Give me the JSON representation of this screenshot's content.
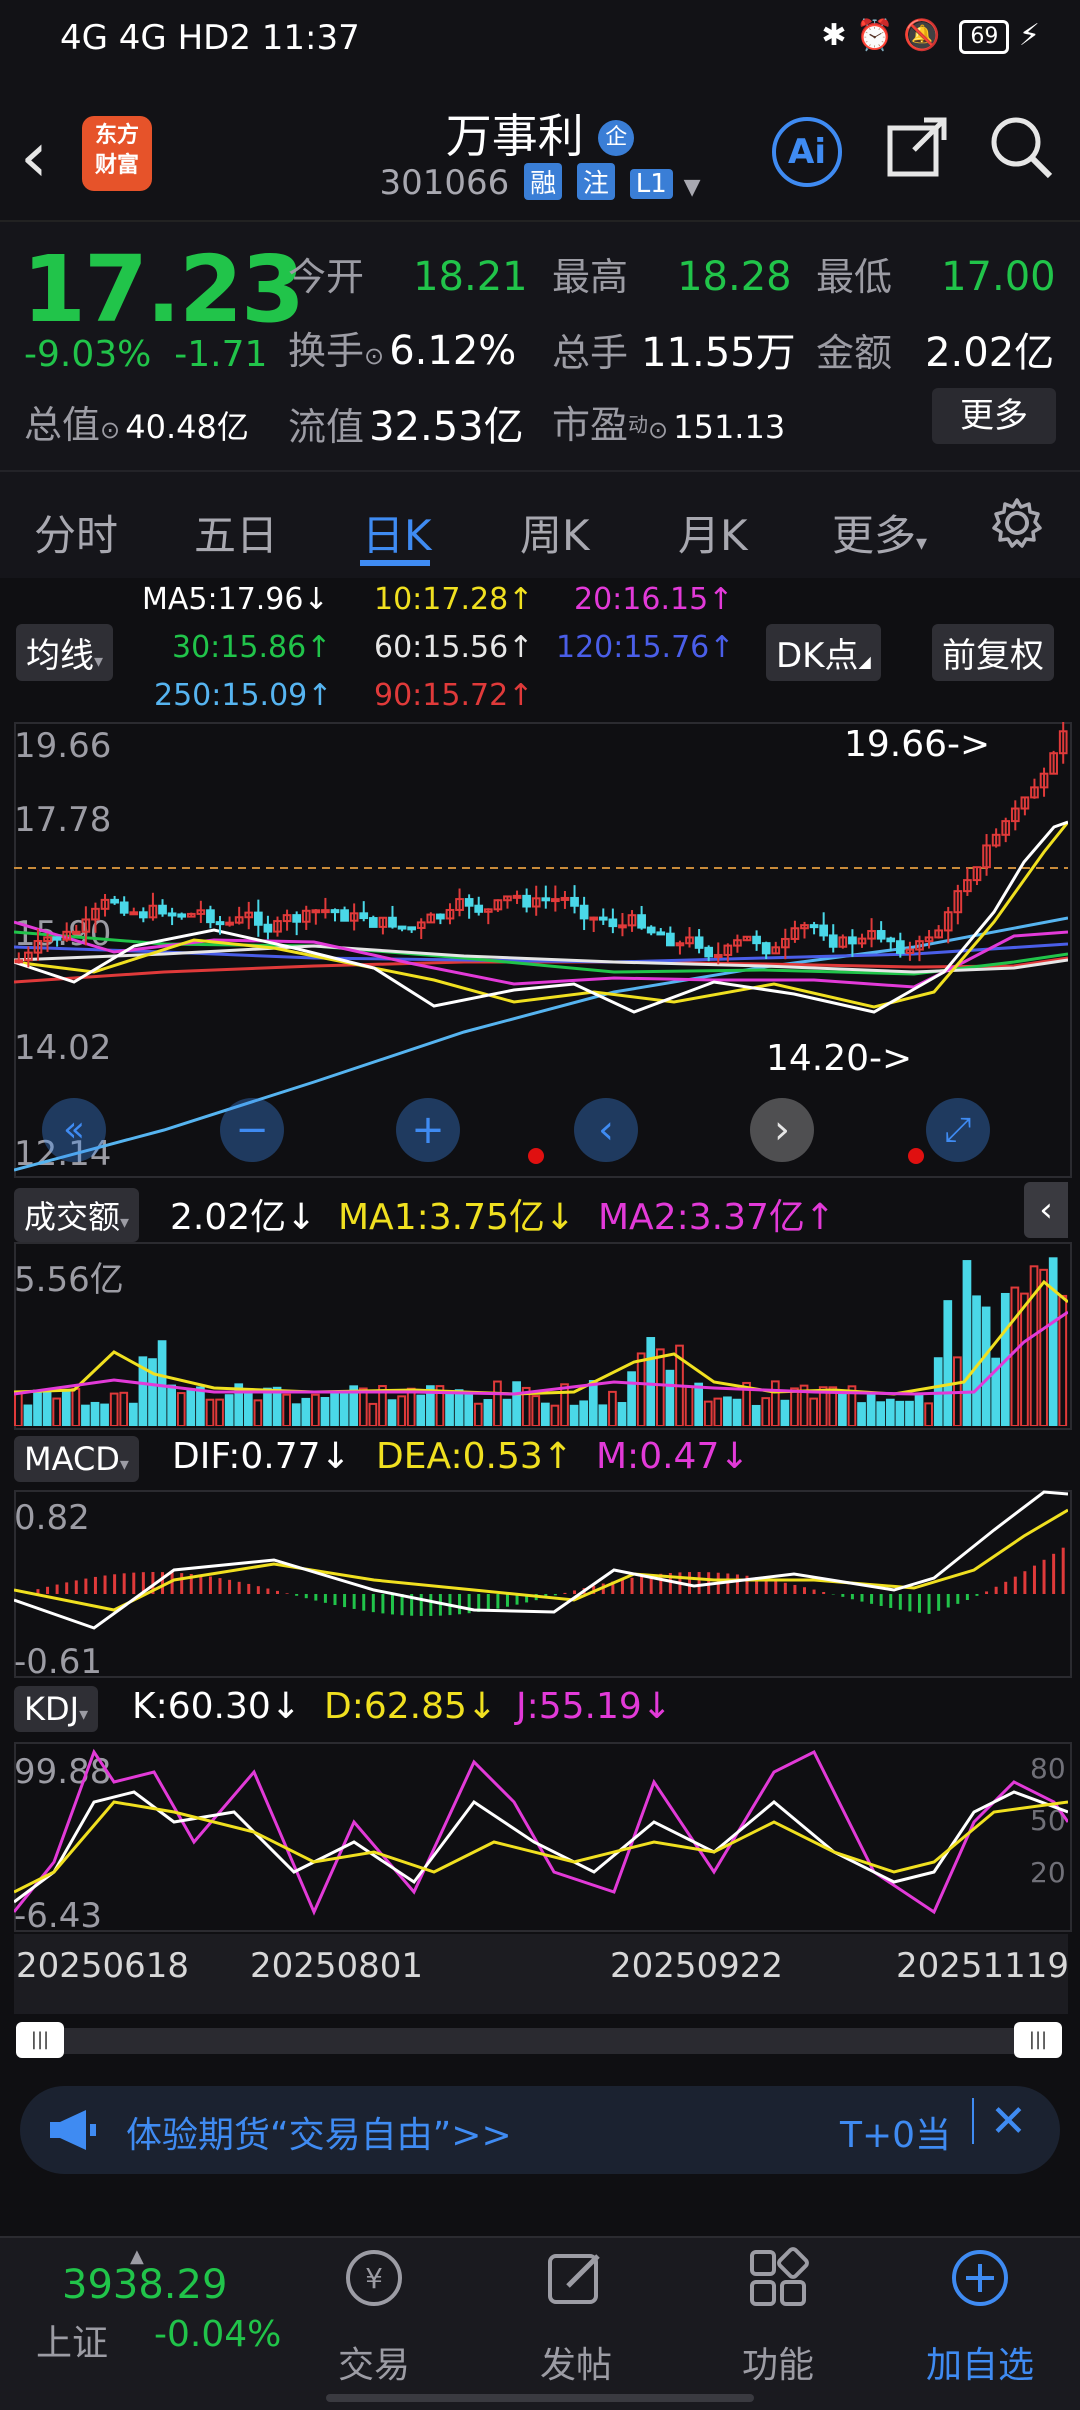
{
  "status_bar": {
    "network": "4G 4G HD2",
    "time": "11:37",
    "battery": "69"
  },
  "header": {
    "logo_text_1": "东方",
    "logo_text_2": "财富",
    "title": "万事利",
    "title_badge": "企",
    "code": "301066",
    "tags": [
      "融",
      "注",
      "L1"
    ],
    "ai_label": "Ai"
  },
  "quote": {
    "price": "17.23",
    "change_pct": "-9.03%",
    "change": "-1.71",
    "open_label": "今开",
    "open": "18.21",
    "high_label": "最高",
    "high": "18.28",
    "low_label": "最低",
    "low": "17.00",
    "turnover_label": "换手",
    "turnover": "6.12%",
    "volume_label": "总手",
    "volume": "11.55万",
    "amount_label": "金额",
    "amount": "2.02亿",
    "mcap_label": "总值",
    "mcap": "40.48亿",
    "float_label": "流值",
    "float": "32.53亿",
    "pe_label": "市盈",
    "pe_sup": "动",
    "pe": "151.13",
    "more": "更多"
  },
  "tabs": [
    "分时",
    "五日",
    "日K",
    "周K",
    "月K",
    "更多"
  ],
  "active_tab": "日K",
  "ma": {
    "ma5": "MA5:17.96↓",
    "ma10": "10:17.28↑",
    "ma20": "20:16.15↑",
    "ma30": "30:15.86↑",
    "ma60": "60:15.56↑",
    "ma120": "120:15.76↑",
    "ma250": "250:15.09↑",
    "ma90": "90:15.72↑"
  },
  "chart_controls": {
    "ma_select": "均线",
    "dk": "DK点",
    "adjust": "前复权"
  },
  "price_axis": {
    "labels": [
      "19.66",
      "17.78",
      "15.90",
      "14.02",
      "12.14"
    ],
    "max_marker": "19.66->",
    "min_marker": "14.20->"
  },
  "volume": {
    "select": "成交额",
    "value": "2.02亿↓",
    "ma1": "MA1:3.75亿↓",
    "ma2": "MA2:3.37亿↑",
    "axis_top": "5.56亿"
  },
  "macd": {
    "select": "MACD",
    "dif": "DIF:0.77↓",
    "dea": "DEA:0.53↑",
    "m": "M:0.47↓",
    "axis_top": "0.82",
    "axis_bottom": "-0.61"
  },
  "kdj": {
    "select": "KDJ",
    "k": "K:60.30↓",
    "d": "D:62.85↓",
    "j": "J:55.19↓",
    "axis_top": "99.88",
    "axis_bottom": "-6.43",
    "levels": [
      "80",
      "50",
      "20"
    ]
  },
  "dates": [
    "20250618",
    "20250801",
    "20250922",
    "20251119"
  ],
  "banner": {
    "text": "体验期货“交易自由”>>",
    "right": "T+0当"
  },
  "bottom_nav": {
    "index_value": "3938.29",
    "index_name": "上证",
    "index_change": "-0.04%",
    "items": [
      "交易",
      "发帖",
      "功能",
      "加自选"
    ]
  },
  "colors": {
    "up": "#e03a3a",
    "down": "#21c44a",
    "accent": "#3f8bf2",
    "bg": "#0f0f12"
  }
}
